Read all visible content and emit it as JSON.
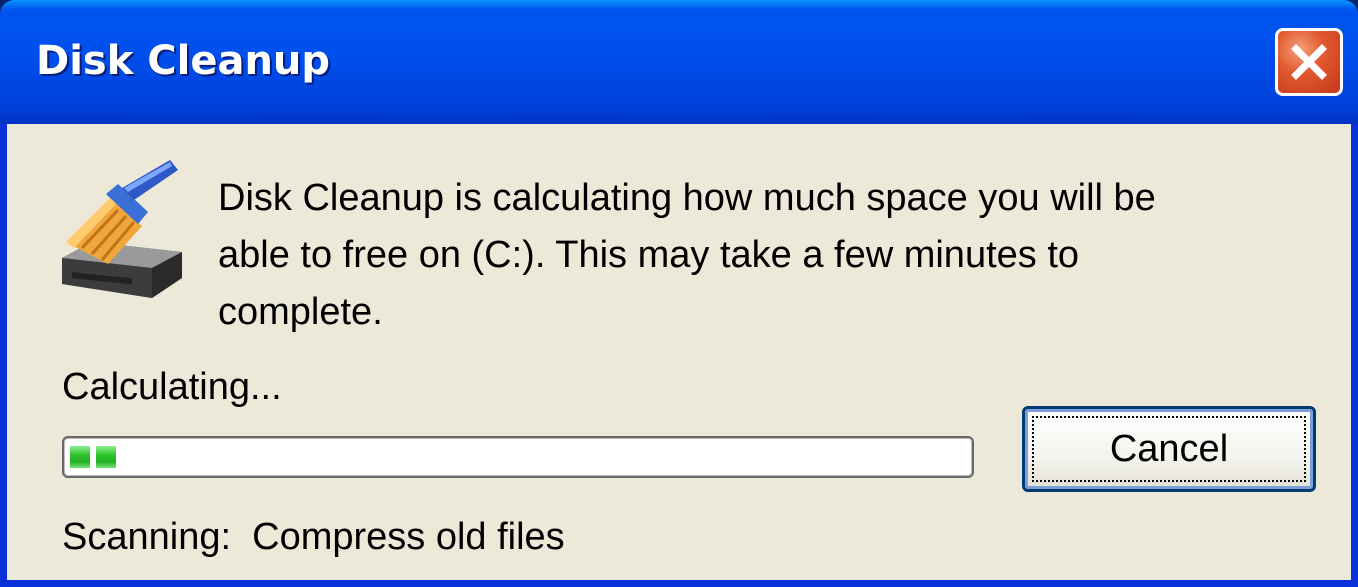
{
  "window": {
    "title": "Disk Cleanup",
    "close_icon": "close-icon"
  },
  "dialog": {
    "icon": "disk-cleanup-broom-icon",
    "message": "Disk Cleanup is calculating how much space you will be\nable to free on  (C:). This may take a few minutes to\ncomplete.",
    "status_label": "Calculating...",
    "progress_chunks": 2,
    "cancel_label": "Cancel",
    "scan_status": "Scanning:  Compress old files"
  },
  "colors": {
    "titlebar": "#0053ee",
    "body": "#ece9d8",
    "progress": "#2fc42f",
    "close": "#e25a2f"
  }
}
